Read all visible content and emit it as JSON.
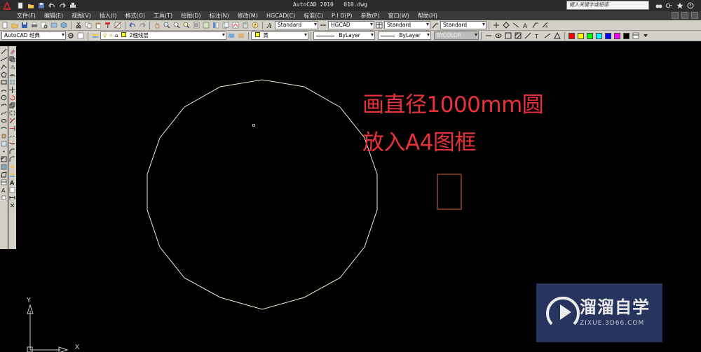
{
  "window": {
    "title": "AutoCAD 2010   010.dwg",
    "search_placeholder": "键入关键字或短语"
  },
  "menu": [
    "文件(F)",
    "编辑(E)",
    "视图(V)",
    "插入(I)",
    "格式(O)",
    "工具(T)",
    "绘图(D)",
    "标注(N)",
    "修改(M)",
    "HGCAD(C)",
    "标准(C)",
    "P I D(P)",
    "参数(P)",
    "窗口(W)",
    "帮助(H)"
  ],
  "toolbar": {
    "text_style": "Standard",
    "dim_style": "HGCAD",
    "table_style": "Standard",
    "multileader_style": "Standard",
    "workspace": "AutoCAD 经典",
    "layer": "2细线层",
    "color": "黄",
    "linetype": "ByLayer",
    "lineweight": "ByLayer",
    "plot_style": "BYCOLOR"
  },
  "palette_colors": [
    "#ff0000",
    "#ffff00",
    "#00ff00",
    "#00ffff",
    "#0000ff",
    "#ff00ff",
    "#000000",
    "#000000"
  ],
  "annotations": {
    "line1": "画直径1000mm圆",
    "line2": "放入A4图框"
  },
  "ucs": {
    "y": "Y",
    "x": "X"
  },
  "watermark": {
    "title": "溜溜自学",
    "subtitle": "ZIXUE.3D66.COM"
  }
}
